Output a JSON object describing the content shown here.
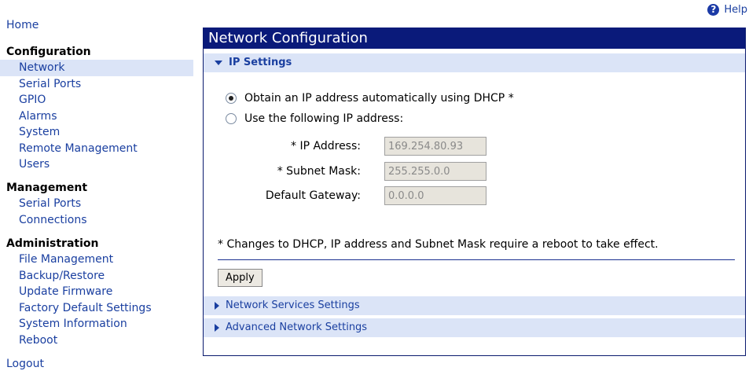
{
  "help": {
    "label": "Help"
  },
  "sidebar": {
    "home": "Home",
    "configuration": {
      "heading": "Configuration",
      "items": [
        "Network",
        "Serial Ports",
        "GPIO",
        "Alarms",
        "System",
        "Remote Management",
        "Users"
      ]
    },
    "management": {
      "heading": "Management",
      "items": [
        "Serial Ports",
        "Connections"
      ]
    },
    "administration": {
      "heading": "Administration",
      "items": [
        "File Management",
        "Backup/Restore",
        "Update Firmware",
        "Factory Default Settings",
        "System Information",
        "Reboot"
      ]
    },
    "logout": "Logout"
  },
  "main": {
    "title": "Network Configuration",
    "ip_settings": {
      "heading": "IP Settings",
      "dhcp_option": "Obtain an IP address automatically using DHCP *",
      "static_option": "Use the following IP address:",
      "ip_label": "* IP Address:",
      "ip_value": "169.254.80.93",
      "mask_label": "* Subnet Mask:",
      "mask_value": "255.255.0.0",
      "gateway_label": "Default Gateway:",
      "gateway_value": "0.0.0.0",
      "note": "* Changes to DHCP, IP address and Subnet Mask require a reboot to take effect.",
      "apply": "Apply"
    },
    "network_services": "Network Services Settings",
    "advanced_network": "Advanced Network Settings"
  }
}
